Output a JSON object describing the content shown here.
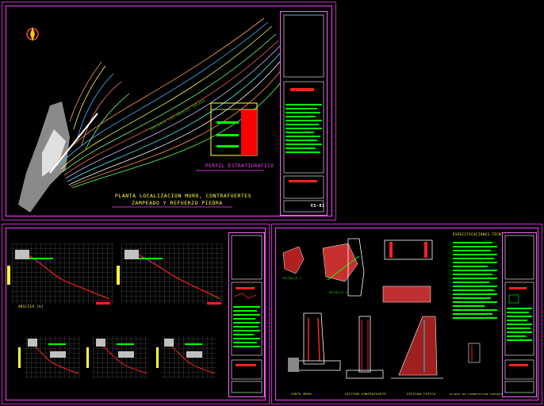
{
  "sheet_main": {
    "title_line1": "PLANTA LOCALIZACION MURO, CONTRAFUERTES",
    "title_line2": "ZAMPEADO Y REFUERZO PIEDRA",
    "profile_title": "PERFIL ESTRATIGRAFICO",
    "road_label": "VARIANTE LOS ANGELES SOLADO",
    "sheet_code": "ES-01"
  },
  "sheet_profiles": {
    "profile_axis_label": "ABSCISA (m)"
  },
  "sheet_details": {
    "notes_title": "ESPECIFICACIONES TECNICAS",
    "detail_a": "DETALLE 1",
    "detail_b": "DETALLE 2",
    "section_a": "CORTE MURO",
    "section_b": "SECCION CONTRAFUERTE",
    "section_c": "SECCION TIPICA",
    "section_d": "PLANTA DE CIMENTACION CONTRAFUERTE Y MURO"
  },
  "colors": {
    "frame": "#ff40ff",
    "grid": "#808080",
    "accent_red": "#ff1010",
    "accent_green": "#00ff00",
    "accent_yellow": "#ffff00"
  }
}
